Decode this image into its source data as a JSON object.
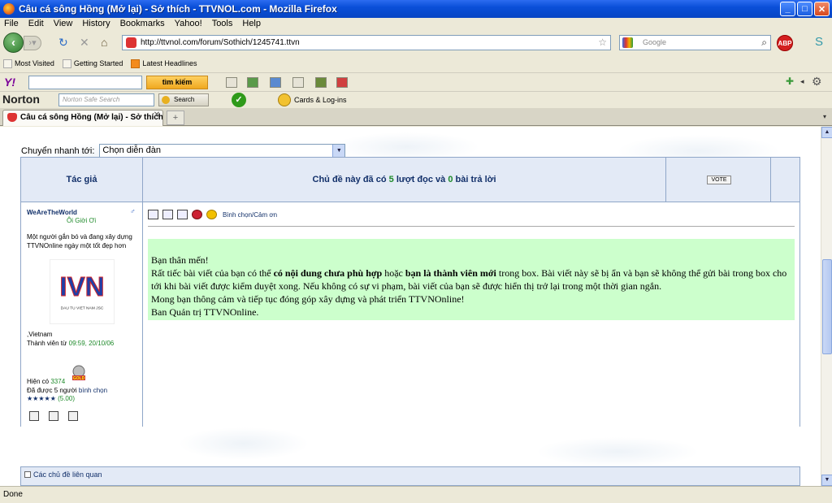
{
  "window": {
    "title": "Câu cá sông Hồng (Mở lại) - Sở thích - TTVNOL.com - Mozilla Firefox",
    "minimize": "_",
    "maximize": "□",
    "close": "✕"
  },
  "menu": [
    "File",
    "Edit",
    "View",
    "History",
    "Bookmarks",
    "Yahoo!",
    "Tools",
    "Help"
  ],
  "nav": {
    "url": "http://ttvnol.com/forum/Sothich/1245741.ttvn",
    "search_placeholder": "Google",
    "abp_label": "ABP"
  },
  "bookmarks": [
    "Most Visited",
    "Getting Started",
    "Latest Headlines"
  ],
  "yahoo_toolbar": {
    "logo": "Y!",
    "search_button": "tìm kiếm"
  },
  "norton_toolbar": {
    "logo": "Norton",
    "search_placeholder": "Norton Safe Search",
    "search_button": "Search",
    "cards_label": "Cards & Log-ins"
  },
  "tabs": [
    {
      "label": "Câu cá sông Hồng (Mở lại) - Sở thích ...",
      "active": true
    }
  ],
  "page": {
    "jump_label": "Chuyển nhanh tới:",
    "jump_select": "Chọn diễn đàn",
    "header": {
      "author_col": "Tác giả",
      "title_prefix": "Chủ đề này đã có",
      "views": "5",
      "views_label": "lượt đọc và",
      "replies": "0",
      "replies_label": "bài trả lời",
      "vote_button": "VOTE"
    },
    "user": {
      "name": "WeAreTheWorld",
      "rank": "Ôi Giời Ơi",
      "bio": "Một người gắn bó và đang xây dựng TTVNOnline ngày một tốt đẹp hơn",
      "logo_text": "IVN",
      "logo_sub": "DAU TU VIET NAM JSC",
      "location": ",Vietnam",
      "member_since_label": "Thành viên từ",
      "member_since": "09:59, 20/10/06",
      "posts_label": "Hiện có",
      "posts": "3374",
      "gold_label": "GOLD",
      "voted_label": "Đã được 5 người",
      "voted_link": "bình chọn",
      "stars": "★★★★★",
      "score": "(5.00)"
    },
    "post": {
      "vote_link": "Bình chọn/Cảm ơn",
      "greeting": "Bạn thân mến!",
      "line1_a": "Rất tiếc bài viết của bạn có thể",
      "line1_b": "có nội dung chưa phù hợp",
      "line1_c": "hoặc",
      "line1_d": "bạn là thành viên mới",
      "line1_e": "trong box. Bài viết này sẽ bị ẩn và bạn sẽ không thể gửi bài trong box cho tới khi bài viết được kiểm duyệt xong. Nếu không có sự vi phạm, bài viết của bạn sẽ được hiển thị trở lại trong một thời gian ngắn.",
      "line2": "Mong bạn thông cảm và tiếp tục đóng góp xây dựng và phát triển TTVNOnline!",
      "signature": "Ban Quản trị TTVNOnline."
    },
    "related": "Các chủ đề liên quan"
  },
  "status": "Done"
}
